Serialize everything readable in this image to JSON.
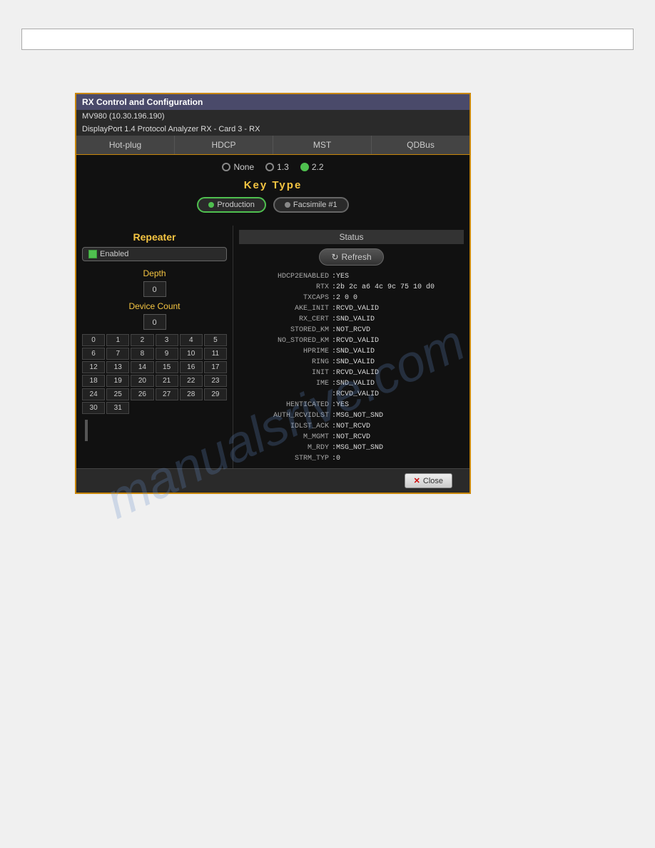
{
  "topbar": {
    "placeholder": ""
  },
  "dialog": {
    "title": "RX Control and Configuration",
    "subtitle1": "MV980 (10.30.196.190)",
    "subtitle2": "DisplayPort 1.4 Protocol Analyzer RX - Card 3 - RX",
    "tabs": [
      {
        "label": "Hot-plug"
      },
      {
        "label": "HDCP"
      },
      {
        "label": "MST"
      },
      {
        "label": "QDBus"
      }
    ],
    "active_tab": "HDCP",
    "hdcp": {
      "versions": [
        {
          "label": "None",
          "selected": false
        },
        {
          "label": "1.3",
          "selected": false
        },
        {
          "label": "2.2",
          "selected": true
        }
      ],
      "key_type_label": "Key  Type",
      "key_options": [
        {
          "label": "Production",
          "selected": true
        },
        {
          "label": "Facsimile #1",
          "selected": false
        }
      ]
    },
    "repeater": {
      "label": "Repeater",
      "enabled_label": "Enabled",
      "depth_label": "Depth",
      "depth_value": "0",
      "device_count_label": "Device Count",
      "device_count_value": "0",
      "grid_row1": [
        "0",
        "1",
        "2",
        "3",
        "4",
        "5"
      ],
      "grid_row2": [
        "6",
        "7",
        "8",
        "9",
        "10",
        "11"
      ],
      "grid_row3": [
        "12",
        "13",
        "14",
        "15",
        "16",
        "17"
      ],
      "grid_row4": [
        "18",
        "19",
        "20",
        "21",
        "22",
        "23"
      ],
      "grid_row5": [
        "24",
        "25",
        "26",
        "27",
        "28",
        "29"
      ],
      "grid_row6": [
        "30",
        "31"
      ]
    },
    "status": {
      "header": "Status",
      "refresh_label": "Refresh",
      "lines": [
        {
          "key": "HDCP2ENABLED",
          "val": ":YES"
        },
        {
          "key": "RTX",
          "val": ":2b 2c a6 4c 9c 75 10 d0"
        },
        {
          "key": "TXCAPS",
          "val": ":2 0 0"
        },
        {
          "key": "AKE_INIT",
          "val": ":RCVD_VALID"
        },
        {
          "key": "RX_CERT",
          "val": ":SND_VALID"
        },
        {
          "key": "STORED_KM",
          "val": ":NOT_RCVD"
        },
        {
          "key": "NO_STORED_KM",
          "val": ":RCVD_VALID"
        },
        {
          "key": "HPRIME",
          "val": ":SND_VALID"
        },
        {
          "key": "RING",
          "val": ":SND_VALID"
        },
        {
          "key": "INIT",
          "val": ":RCVD_VALID"
        },
        {
          "key": "IME",
          "val": ":SND_VALID"
        },
        {
          "key": "",
          "val": ":RCVD_VALID"
        },
        {
          "key": "HENTICATED",
          "val": ":YES"
        },
        {
          "key": "AUTH_RCVIDLST",
          "val": ":MSG_NOT_SND"
        },
        {
          "key": "IDLST_ACK",
          "val": ":NOT_RCVD"
        },
        {
          "key": "M_MGMT",
          "val": ":NOT_RCVD"
        },
        {
          "key": "M_RDY",
          "val": ":MSG_NOT_SND"
        },
        {
          "key": "STRM_TYP",
          "val": ":0"
        }
      ]
    },
    "footer": {
      "close_label": "Close"
    }
  },
  "watermark": "manualsrive.com"
}
